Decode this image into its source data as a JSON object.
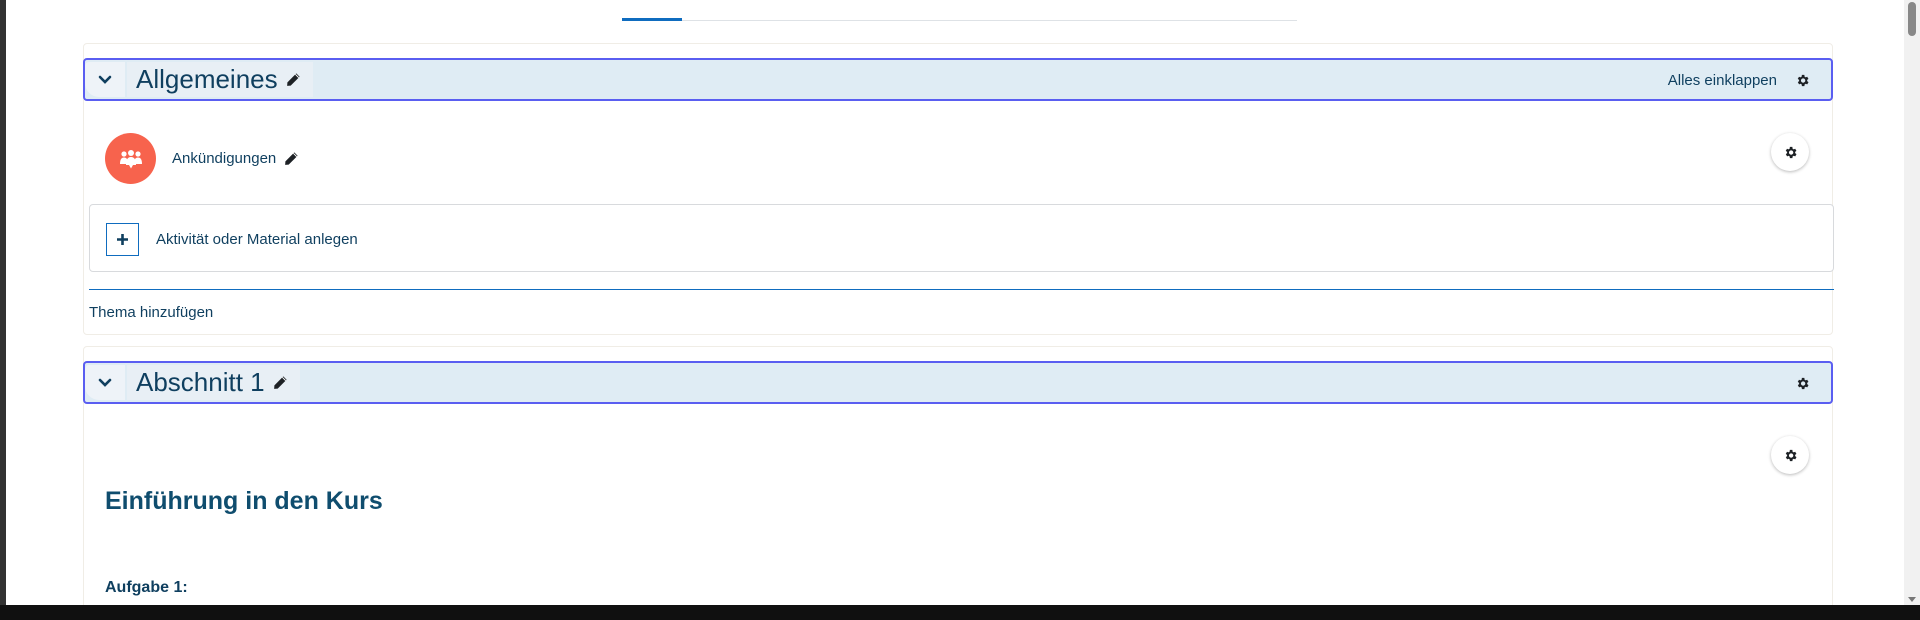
{
  "sections": [
    {
      "title": "Allgemeines",
      "collapse_all_label": "Alles einklappen"
    },
    {
      "title": "Abschnitt 1"
    }
  ],
  "activity": {
    "name": "Ankündigungen",
    "icon": "forum-icon",
    "icon_color": "#f7634d"
  },
  "add_activity_label": "Aktivität oder Material anlegen",
  "add_topic_label": "Thema hinzufügen",
  "section1_summary": {
    "heading": "Einführung in den Kurs",
    "task_label": "Aufgabe 1:"
  },
  "colors": {
    "header_bg": "#dfecf4",
    "header_border": "#5a5ef1",
    "link": "#0f3f5f",
    "accent": "#0f6cbf"
  }
}
